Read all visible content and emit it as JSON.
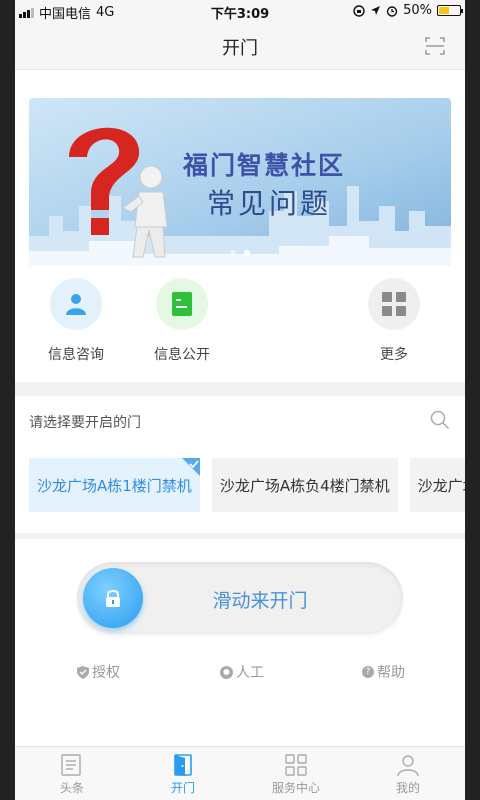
{
  "status_bar": {
    "carrier": "中国电信",
    "network": "4G",
    "time": "下午3:09",
    "battery": "50%",
    "battery_level": 0.5
  },
  "navbar": {
    "title": "开门",
    "scan_icon": "scan-icon"
  },
  "banner": {
    "title": "福门智慧社区",
    "subtitle": "常见问题",
    "dots_total": 2,
    "dot_active": 2
  },
  "quick_actions": [
    {
      "label": "信息咨询",
      "icon": "person-icon",
      "bg": "#e3f1fd",
      "color": "#3aa2ea"
    },
    {
      "label": "信息公开",
      "icon": "document-icon",
      "bg": "#e5f8e4",
      "color": "#2fc13a"
    },
    {
      "label": "更多",
      "icon": "grid-icon",
      "bg": "#efefef",
      "color": "#8a8a8a"
    }
  ],
  "doors": {
    "header": "请选择要开启的门",
    "items": [
      {
        "label": "沙龙广场A栋1楼门禁机",
        "selected": true
      },
      {
        "label": "沙龙广场A栋负4楼门禁机",
        "selected": false
      },
      {
        "label": "沙龙广场A栋",
        "selected": false
      }
    ]
  },
  "slider": {
    "label": "滑动来开门"
  },
  "options": {
    "authorize": "授权",
    "manual": "人工",
    "help": "帮助"
  },
  "tabbar": {
    "items": [
      {
        "label": "头条",
        "icon": "news-icon"
      },
      {
        "label": "开门",
        "icon": "door-icon"
      },
      {
        "label": "服务中心",
        "icon": "grid-icon"
      },
      {
        "label": "我的",
        "icon": "profile-icon"
      }
    ],
    "active": 1
  },
  "colors": {
    "accent": "#2a9cf0",
    "selected_bg": "#e4f2fd"
  }
}
